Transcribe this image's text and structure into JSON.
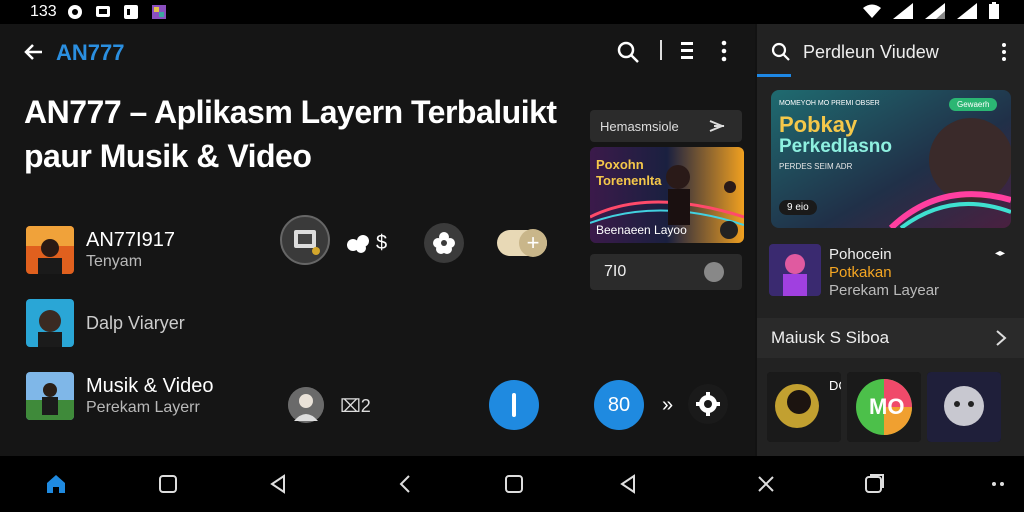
{
  "status": {
    "time": "133"
  },
  "header": {
    "app_title": "AN777"
  },
  "page": {
    "title": "AN777 – Aplikasm Layern Terbaluikt paur Musik  & Video"
  },
  "rows": [
    {
      "title": "AN77I917",
      "sub": "Tenyam"
    },
    {
      "title": "Dalp Viaryer",
      "sub": ""
    },
    {
      "title": "Musik & Video",
      "sub": "Perekam Layerr"
    }
  ],
  "controls": {
    "dollar_label": "$",
    "pip_label": "⌧2",
    "badge_label": "80",
    "forward_label": "»"
  },
  "side_cards": {
    "pill_label": "Hemasmsiole",
    "video_title_1": "Poxohn",
    "video_title_2": "Torenenlta",
    "video_caption": "Beenaeen Layoo",
    "score_label": "7I0"
  },
  "right_panel": {
    "search_title": "Perdleun Viudew",
    "hero": {
      "tag": "Gewaerh",
      "title_1": "Pobkay",
      "title_2": "Perkedlasno",
      "subtitle": "PERDES SEIM ADR",
      "duration": "9 eio",
      "top_text": "MOMEYOH MO PREMI OBSER"
    },
    "item": {
      "line_1": "Pohocein",
      "line_2": "Potkakan",
      "line_3": "Perekam Layear"
    },
    "section_title": "Maiusk S Siboa",
    "thumbs_badge": "MO",
    "thumbs_label": "DC"
  },
  "colors": {
    "accent": "#2b8fe0",
    "blue_button": "#1f8ae0",
    "orange_label": "#f5a623"
  },
  "icons": [
    "back-arrow-icon",
    "search-icon",
    "list-icon",
    "more-vert-icon",
    "home-icon",
    "square-icon",
    "triangle-back-icon",
    "chevron-left-icon",
    "close-icon"
  ]
}
